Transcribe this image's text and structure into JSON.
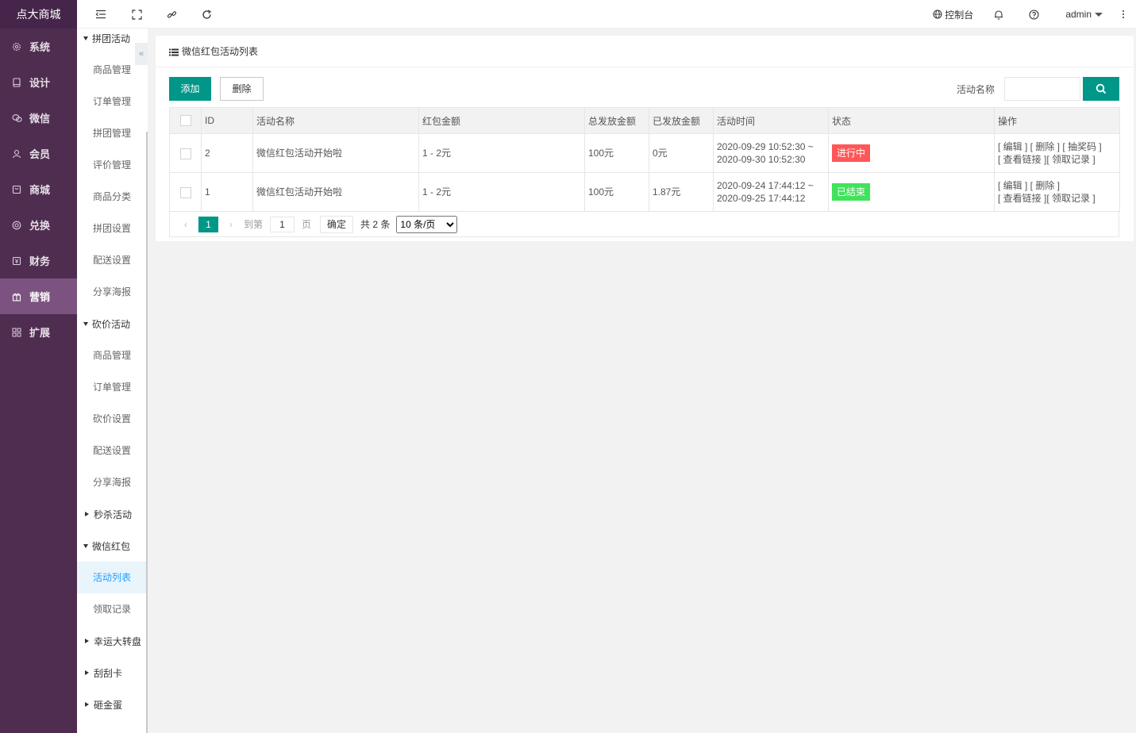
{
  "app": {
    "logo": "点大商城"
  },
  "main_nav": [
    {
      "label": "系统",
      "icon": "gear-icon"
    },
    {
      "label": "设计",
      "icon": "tablet-icon"
    },
    {
      "label": "微信",
      "icon": "wechat-icon"
    },
    {
      "label": "会员",
      "icon": "user-icon"
    },
    {
      "label": "商城",
      "icon": "shop-icon"
    },
    {
      "label": "兑换",
      "icon": "coin-icon"
    },
    {
      "label": "财务",
      "icon": "finance-icon"
    },
    {
      "label": "营销",
      "icon": "gift-icon",
      "active": true
    },
    {
      "label": "扩展",
      "icon": "grid-icon"
    }
  ],
  "sub_nav": {
    "groups": [
      {
        "label": "拼团活动",
        "expanded": true,
        "items": [
          "商品管理",
          "订单管理",
          "拼团管理",
          "评价管理",
          "商品分类",
          "拼团设置",
          "配送设置",
          "分享海报"
        ]
      },
      {
        "label": "砍价活动",
        "expanded": true,
        "items": [
          "商品管理",
          "订单管理",
          "砍价设置",
          "配送设置",
          "分享海报"
        ]
      },
      {
        "label": "秒杀活动",
        "expanded": false,
        "items": []
      },
      {
        "label": "微信红包",
        "expanded": true,
        "items": [
          "活动列表",
          "领取记录"
        ],
        "active_item": "活动列表"
      },
      {
        "label": "幸运大转盘",
        "expanded": false,
        "items": []
      },
      {
        "label": "刮刮卡",
        "expanded": false,
        "items": []
      },
      {
        "label": "砸金蛋",
        "expanded": false,
        "items": []
      }
    ]
  },
  "topbar": {
    "console_label": "控制台",
    "user_label": "admin"
  },
  "panel": {
    "title": "微信红包活动列表",
    "add_label": "添加",
    "delete_label": "删除",
    "search_label": "活动名称",
    "search_value": ""
  },
  "table": {
    "headers": [
      "ID",
      "活动名称",
      "红包金额",
      "总发放金额",
      "已发放金额",
      "活动时间",
      "状态",
      "操作"
    ],
    "rows": [
      {
        "id": "2",
        "name": "微信红包活动开始啦",
        "amount": "1 - 2元",
        "total": "100元",
        "issued": "0元",
        "time_start": "2020-09-29 10:52:30 ~",
        "time_end": "2020-09-30 10:52:30",
        "status": "进行中",
        "status_color": "#ff5757",
        "actions_line1": "[ 编辑 ] [ 删除 ] [ 抽奖码 ]",
        "actions_line2": "[ 查看链接 ][ 领取记录 ]"
      },
      {
        "id": "1",
        "name": "微信红包活动开始啦",
        "amount": "1 - 2元",
        "total": "100元",
        "issued": "1.87元",
        "time_start": "2020-09-24 17:44:12 ~",
        "time_end": "2020-09-25 17:44:12",
        "status": "已结束",
        "status_color": "#3fe35c",
        "actions_line1": "[ 编辑 ] [ 删除 ]",
        "actions_line2": "[ 查看链接 ][ 领取记录 ]"
      }
    ]
  },
  "pager": {
    "current": "1",
    "goto_label": "到第",
    "page_input": "1",
    "page_unit": "页",
    "confirm_label": "确定",
    "total_text": "共 2 条",
    "page_size": "10 条/页"
  }
}
